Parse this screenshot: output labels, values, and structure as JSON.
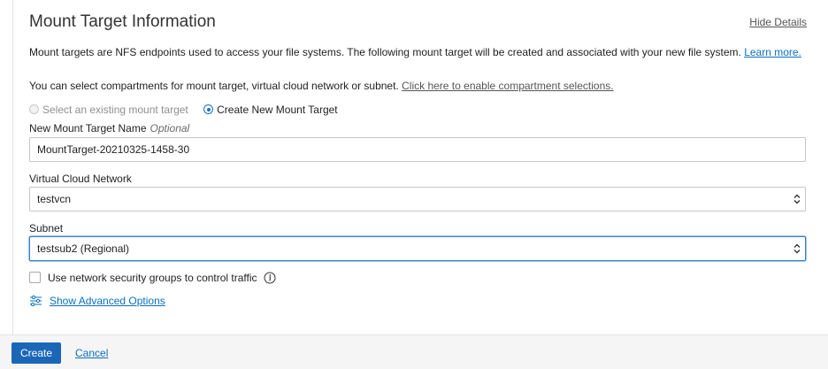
{
  "section": {
    "title": "Mount Target Information",
    "hide_details": "Hide Details",
    "description": "Mount targets are NFS endpoints used to access your file systems. The following mount target will be created and associated with your new file system.",
    "learn_more": "Learn more.",
    "compartment_text": "You can select compartments for mount target, virtual cloud network or subnet.",
    "compartment_link": "Click here to enable compartment selections."
  },
  "mount_target_choice": {
    "existing_label": "Select an existing mount target",
    "new_label": "Create New Mount Target",
    "selected": "new"
  },
  "mount_target_name": {
    "label": "New Mount Target Name",
    "optional": "Optional",
    "value": "MountTarget-20210325-1458-30"
  },
  "vcn": {
    "label": "Virtual Cloud Network",
    "value": "testvcn"
  },
  "subnet": {
    "label": "Subnet",
    "value": "testsub2 (Regional)"
  },
  "nsg": {
    "label": "Use network security groups to control traffic",
    "checked": false
  },
  "advanced": {
    "label": "Show Advanced Options"
  },
  "footer": {
    "create_label": "Create",
    "cancel_label": "Cancel"
  },
  "colors": {
    "accent": "#1a67b8",
    "link": "#0a6fbf"
  },
  "icons": {
    "info": "info-icon",
    "advanced": "sliders-icon",
    "select_caret": "up-down-caret-icon"
  }
}
